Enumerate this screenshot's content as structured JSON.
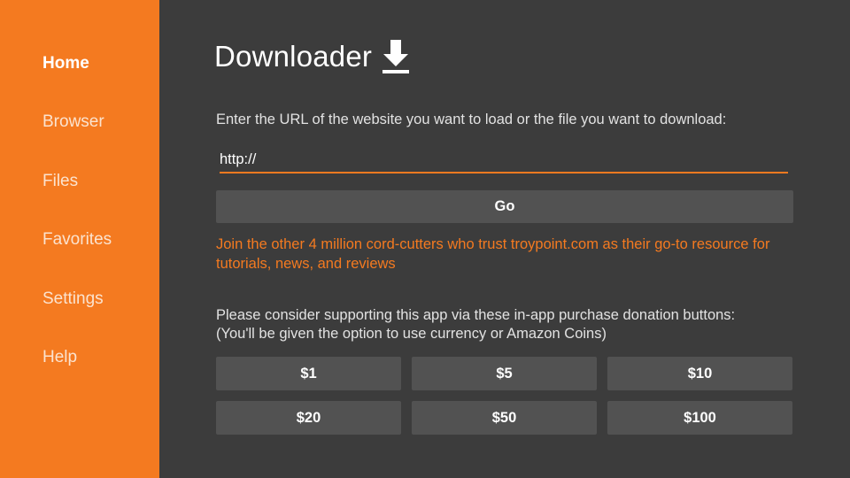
{
  "sidebar": {
    "items": [
      {
        "label": "Home",
        "active": true
      },
      {
        "label": "Browser",
        "active": false
      },
      {
        "label": "Files",
        "active": false
      },
      {
        "label": "Favorites",
        "active": false
      },
      {
        "label": "Settings",
        "active": false
      },
      {
        "label": "Help",
        "active": false
      }
    ]
  },
  "header": {
    "title": "Downloader",
    "icon": "download-arrow-icon"
  },
  "main": {
    "prompt": "Enter the URL of the website you want to load or the file you want to download:",
    "url_input": {
      "value": "http://",
      "placeholder": ""
    },
    "go_label": "Go",
    "promo_text": "Join the other 4 million cord-cutters who trust troypoint.com as their go-to resource for tutorials, news, and reviews",
    "donate_line1": "Please consider supporting this app via these in-app purchase donation buttons:",
    "donate_line2": "(You'll be given the option to use currency or Amazon Coins)",
    "donations": [
      "$1",
      "$5",
      "$10",
      "$20",
      "$50",
      "$100"
    ]
  },
  "colors": {
    "accent": "#f47a20",
    "background": "#3c3c3c",
    "button": "#525252"
  }
}
